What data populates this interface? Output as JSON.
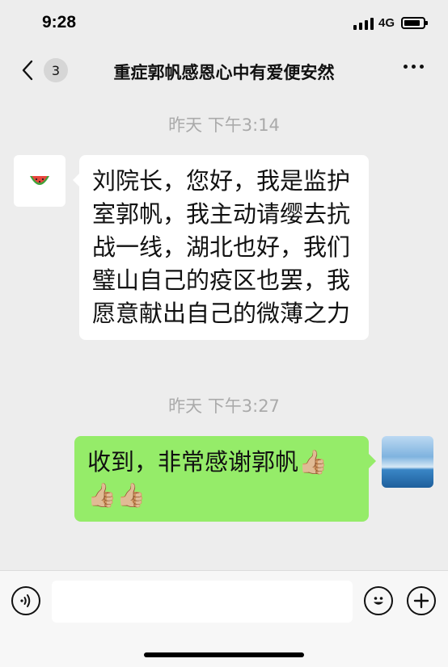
{
  "status_bar": {
    "time": "9:28",
    "network": "4G",
    "battery_level": 0.85
  },
  "nav": {
    "unread_count": "3",
    "title": "重症郭帆感恩心中有爱便安然"
  },
  "messages": [
    {
      "timestamp": "昨天 下午3:14",
      "direction": "incoming",
      "avatar_icon": "watermelon-icon",
      "text": "刘院长，您好，我是监护室郭帆，我主动请缨去抗战一线，湖北也好，我们璧山自己的疫区也罢，我愿意献出自己的微薄之力"
    },
    {
      "timestamp": "昨天 下午3:27",
      "direction": "outgoing",
      "avatar_icon": "ocean-sky-avatar",
      "text": "收到，非常感谢郭帆👍🏼👍🏼👍🏼"
    }
  ],
  "input_bar": {
    "voice_icon": "voice-icon",
    "emoji_icon": "emoji-icon",
    "plus_icon": "plus-icon",
    "input_value": ""
  },
  "colors": {
    "background": "#ededed",
    "outgoing_bubble": "#95ec69",
    "incoming_bubble": "#ffffff",
    "timestamp": "#aaaaaa"
  }
}
